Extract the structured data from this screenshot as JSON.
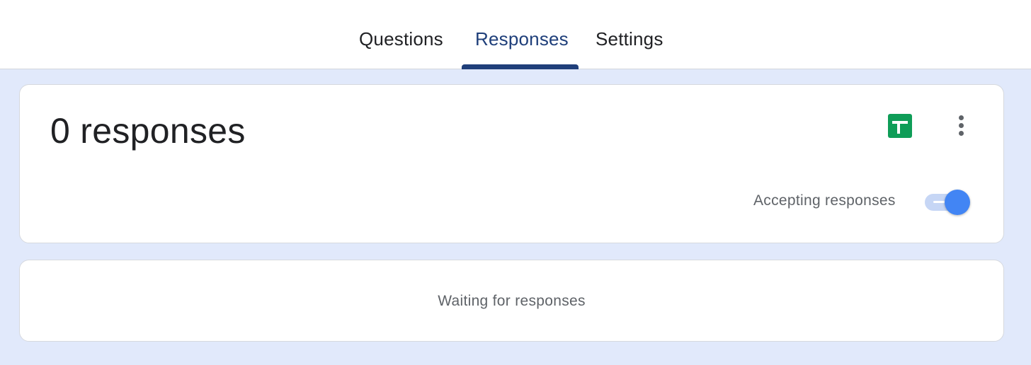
{
  "tabs": [
    {
      "label": "Questions",
      "active": false
    },
    {
      "label": "Responses",
      "active": true
    },
    {
      "label": "Settings",
      "active": false
    }
  ],
  "summary": {
    "count_label": "0 responses",
    "sheets_icon": "google-sheets-icon",
    "more_icon": "more-vert-icon",
    "accepting_label": "Accepting responses",
    "accepting_on": true
  },
  "empty_state": {
    "message": "Waiting for responses"
  },
  "colors": {
    "active_tab": "#1f3f7a",
    "background": "#e1e9fb",
    "sheets_green": "#0f9d58",
    "toggle_blue": "#4285f4"
  }
}
